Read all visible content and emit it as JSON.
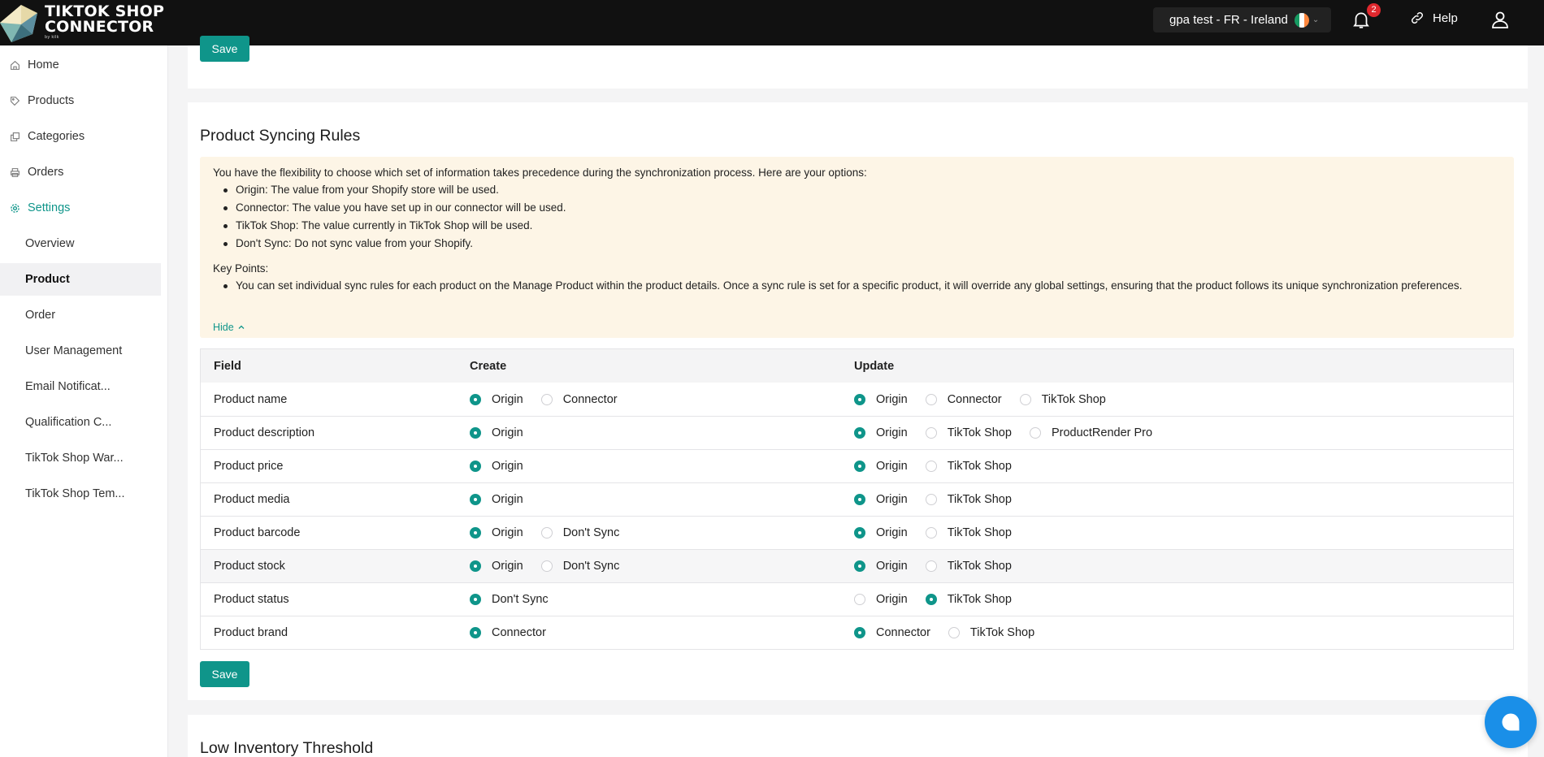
{
  "header": {
    "logo_line1": "TIKTOK SHOP",
    "logo_line2": "CONNECTOR",
    "logo_by": "by kilk",
    "store": "gpa test - FR  -  Ireland",
    "notification_count": "2",
    "help": "Help"
  },
  "sidebar": {
    "items": [
      {
        "label": "Home",
        "icon": "home-icon"
      },
      {
        "label": "Products",
        "icon": "tag-icon"
      },
      {
        "label": "Categories",
        "icon": "copy-icon"
      },
      {
        "label": "Orders",
        "icon": "printer-icon"
      },
      {
        "label": "Settings",
        "icon": "gear-icon"
      }
    ],
    "settings_sub": [
      "Overview",
      "Product",
      "Order",
      "User Management",
      "Email Notificat...",
      "Qualification C...",
      "TikTok Shop War...",
      "TikTok Shop Tem..."
    ]
  },
  "main": {
    "top_save": "Save",
    "title": "Product Syncing Rules",
    "info": {
      "intro": "You have the flexibility to choose which set of information takes precedence during the synchronization process. Here are your options:",
      "options": [
        "Origin: The value from your Shopify store will be used.",
        "Connector: The value you have set up in our connector will be used.",
        "TikTok Shop: The value currently in TikTok Shop will be used.",
        "Don't Sync: Do not sync value from your Shopify."
      ],
      "key_points_label": "Key Points:",
      "key_points": [
        "You can set individual sync rules for each product on the Manage Product within the product details. Once a sync rule is set for a specific product, it will override any global settings, ensuring that the product follows its unique synchronization preferences."
      ],
      "hide": "Hide"
    },
    "table": {
      "headers": {
        "field": "Field",
        "create": "Create",
        "update": "Update"
      },
      "rows": [
        {
          "field": "Product name",
          "create": [
            {
              "label": "Origin",
              "on": true
            },
            {
              "label": "Connector",
              "on": false
            }
          ],
          "update": [
            {
              "label": "Origin",
              "on": true
            },
            {
              "label": "Connector",
              "on": false
            },
            {
              "label": "TikTok Shop",
              "on": false
            }
          ]
        },
        {
          "field": "Product description",
          "create": [
            {
              "label": "Origin",
              "on": true
            }
          ],
          "update": [
            {
              "label": "Origin",
              "on": true
            },
            {
              "label": "TikTok Shop",
              "on": false
            },
            {
              "label": "ProductRender Pro",
              "on": false
            }
          ]
        },
        {
          "field": "Product price",
          "create": [
            {
              "label": "Origin",
              "on": true
            }
          ],
          "update": [
            {
              "label": "Origin",
              "on": true
            },
            {
              "label": "TikTok Shop",
              "on": false
            }
          ]
        },
        {
          "field": "Product media",
          "create": [
            {
              "label": "Origin",
              "on": true
            }
          ],
          "update": [
            {
              "label": "Origin",
              "on": true
            },
            {
              "label": "TikTok Shop",
              "on": false
            }
          ]
        },
        {
          "field": "Product barcode",
          "create": [
            {
              "label": "Origin",
              "on": true
            },
            {
              "label": "Don't Sync",
              "on": false
            }
          ],
          "update": [
            {
              "label": "Origin",
              "on": true
            },
            {
              "label": "TikTok Shop",
              "on": false
            }
          ]
        },
        {
          "field": "Product stock",
          "create": [
            {
              "label": "Origin",
              "on": true
            },
            {
              "label": "Don't Sync",
              "on": false
            }
          ],
          "update": [
            {
              "label": "Origin",
              "on": true
            },
            {
              "label": "TikTok Shop",
              "on": false
            }
          ]
        },
        {
          "field": "Product status",
          "create": [
            {
              "label": "Don't Sync",
              "on": true
            }
          ],
          "update": [
            {
              "label": "Origin",
              "on": false
            },
            {
              "label": "TikTok Shop",
              "on": true
            }
          ]
        },
        {
          "field": "Product brand",
          "create": [
            {
              "label": "Connector",
              "on": true
            }
          ],
          "update": [
            {
              "label": "Connector",
              "on": true
            },
            {
              "label": "TikTok Shop",
              "on": false
            }
          ]
        }
      ]
    },
    "save": "Save",
    "next_title": "Low Inventory Threshold"
  },
  "colors": {
    "accent": "#0f958a",
    "info_bg": "#fdf5e6",
    "topbar": "#111111",
    "badge": "#e0282e",
    "chat": "#1a8fe8"
  }
}
